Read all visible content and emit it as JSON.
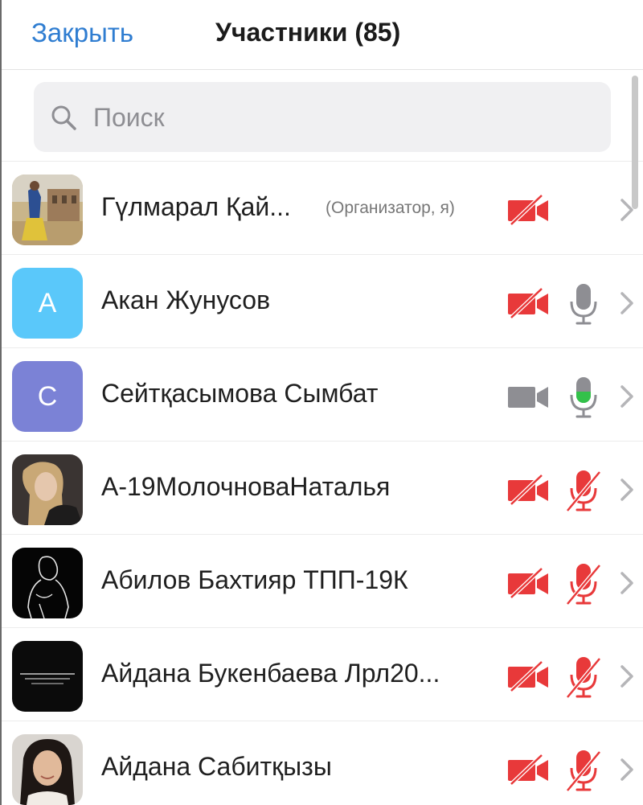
{
  "header": {
    "close_label": "Закрыть",
    "title": "Участники (85)"
  },
  "search": {
    "placeholder": "Поиск"
  },
  "participants": [
    {
      "name": "Гүлмарал Қай...",
      "role": "(Организатор, я)",
      "avatar": "photo",
      "video": "off",
      "mic": "none"
    },
    {
      "name": "Акан Жунусов",
      "avatar_letter": "A",
      "avatar_color": "#5ac8fa",
      "video": "off",
      "mic": "on-idle"
    },
    {
      "name": "Сейтқасымова Сымбат",
      "avatar_letter": "C",
      "avatar_color": "#7b82d6",
      "video": "on-idle",
      "mic": "on-active"
    },
    {
      "name": "А-19МолочноваНаталья",
      "avatar": "photo",
      "video": "off",
      "mic": "off"
    },
    {
      "name": "Абилов Бахтияр ТПП-19К",
      "avatar": "photo",
      "video": "off",
      "mic": "off"
    },
    {
      "name": "Айдана Букенбаева Лрл20...",
      "avatar": "photo",
      "video": "off",
      "mic": "off"
    },
    {
      "name": "Айдана Сабитқызы",
      "avatar": "photo",
      "video": "off",
      "mic": "off"
    }
  ],
  "colors": {
    "accent": "#2f7dd1",
    "muted_red": "#e8393a",
    "active_green": "#33c14a",
    "icon_gray": "#8e8e93"
  },
  "icons": [
    "search-icon",
    "video-off-icon",
    "video-icon",
    "mic-icon",
    "mic-off-icon",
    "chevron-right-icon"
  ]
}
